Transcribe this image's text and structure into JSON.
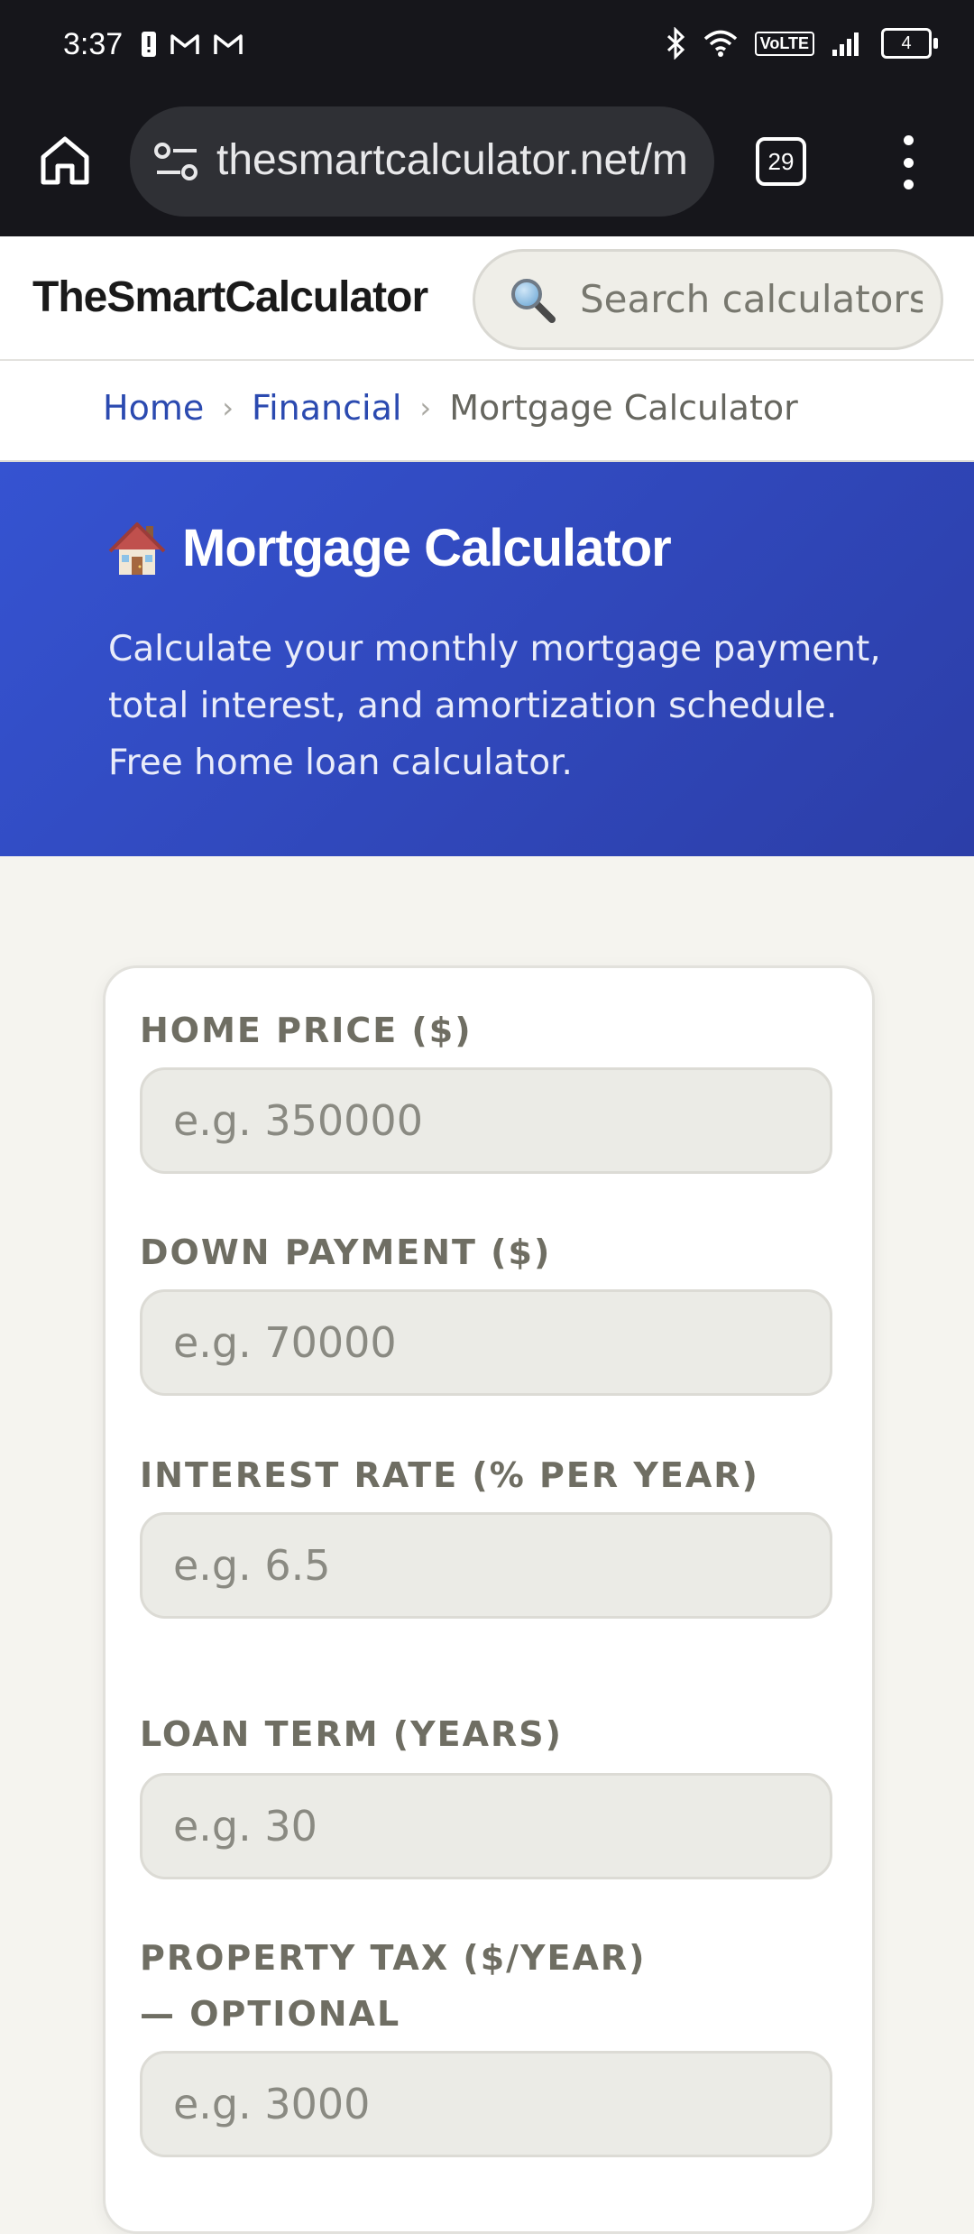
{
  "status_bar": {
    "time": "3:37",
    "left_icons": [
      "alert-icon",
      "gmail-icon",
      "gmail-icon"
    ],
    "right_icons": [
      "bluetooth-icon",
      "wifi-icon",
      "volte-icon",
      "signal-icon",
      "battery-icon"
    ],
    "volte_label": "VoLTE",
    "battery_level": "4"
  },
  "browser": {
    "url": "thesmartcalculator.net/m",
    "tab_count": "29"
  },
  "site": {
    "logo": "TheSmartCalculator",
    "search_placeholder": "Search calculators..."
  },
  "breadcrumb": {
    "items": [
      {
        "label": "Home",
        "link": true
      },
      {
        "label": "Financial",
        "link": true
      },
      {
        "label": "Mortgage Calculator",
        "link": false
      }
    ],
    "separator": "›"
  },
  "hero": {
    "title": "Mortgage Calculator",
    "description": "Calculate your monthly mortgage payment, total interest, and amortization schedule. Free home loan calculator."
  },
  "form": {
    "fields": [
      {
        "label": "HOME PRICE ($)",
        "placeholder": "e.g. 350000"
      },
      {
        "label": "DOWN PAYMENT ($)",
        "placeholder": "e.g. 70000"
      },
      {
        "label": "INTEREST RATE (% PER YEAR)",
        "placeholder": "e.g. 6.5"
      },
      {
        "label": "LOAN TERM (YEARS)",
        "placeholder": "e.g. 30"
      },
      {
        "label": "PROPERTY TAX ($/YEAR) — OPTIONAL",
        "placeholder": "e.g. 3000"
      }
    ]
  },
  "colors": {
    "hero_gradient_start": "#3553d1",
    "hero_gradient_end": "#2c3ea8",
    "link": "#2b4ab0",
    "page_background": "#f5f4ef"
  }
}
